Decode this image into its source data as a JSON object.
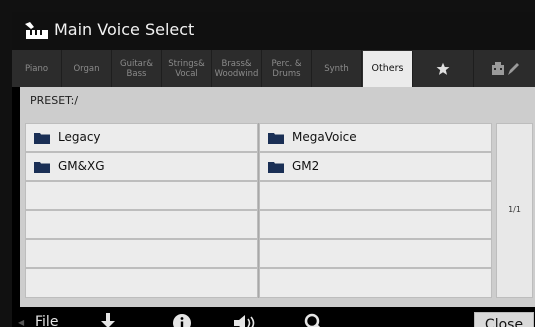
{
  "header": {
    "title": "Main Voice Select",
    "icon": "keyboard-hand-icon"
  },
  "tabs": [
    {
      "label": "Piano"
    },
    {
      "label": "Organ"
    },
    {
      "label": "Guitar&\nBass"
    },
    {
      "label": "Strings&\nVocal"
    },
    {
      "label": "Brass&\nWoodwind"
    },
    {
      "label": "Perc. &\nDrums"
    },
    {
      "label": "Synth"
    },
    {
      "label": "Others",
      "active": true
    },
    {
      "icon": "star-icon"
    },
    {
      "icon": "user-edit-icon"
    }
  ],
  "path": "PRESET:/",
  "folders": [
    {
      "label": "Legacy"
    },
    {
      "label": "MegaVoice"
    },
    {
      "label": "GM&XG"
    },
    {
      "label": "GM2"
    }
  ],
  "pager": {
    "label": "1/1"
  },
  "bottom": {
    "file_label": "File",
    "close_label": "Close",
    "icons": [
      "save-icon",
      "info-icon",
      "speaker-icon",
      "search-icon"
    ]
  },
  "colors": {
    "background": "#000000",
    "tab_bar": "#2c2c2c",
    "active_tab": "#ebebeb",
    "list_panel": "#cdcdcd",
    "folder": "#1a2f55"
  }
}
